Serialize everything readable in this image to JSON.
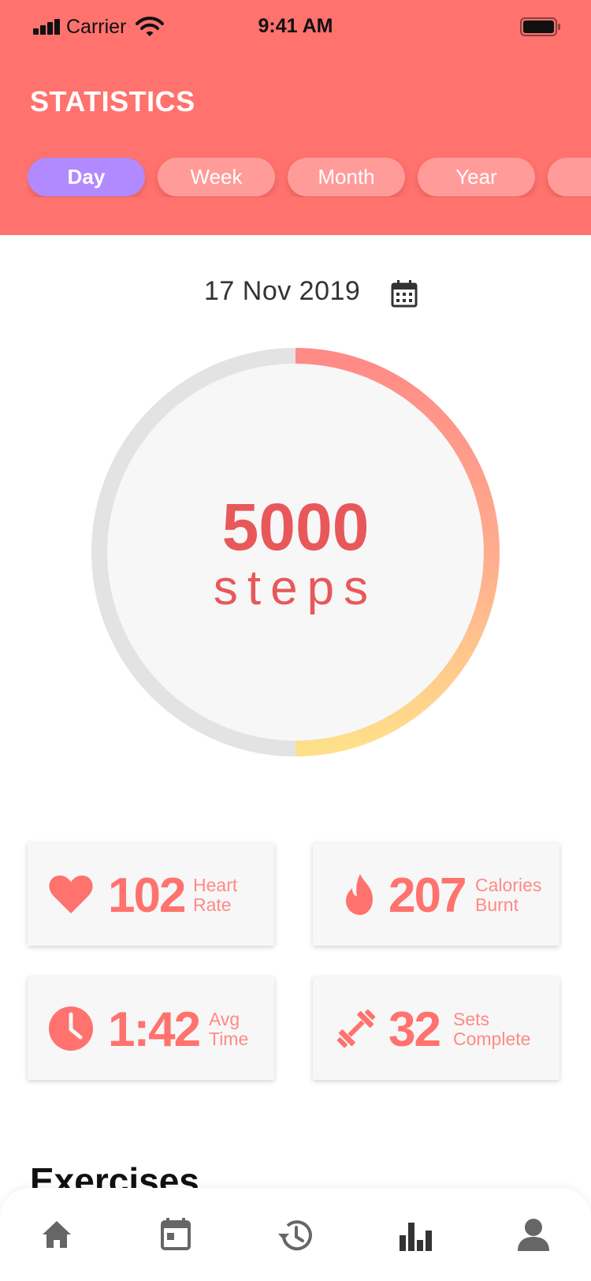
{
  "status_bar": {
    "carrier": "Carrier",
    "time": "9:41 AM"
  },
  "header": {
    "title": "STATISTICS"
  },
  "tabs": [
    {
      "label": "Day",
      "active": true
    },
    {
      "label": "Week",
      "active": false
    },
    {
      "label": "Month",
      "active": false
    },
    {
      "label": "Year",
      "active": false
    },
    {
      "label": "",
      "active": false
    }
  ],
  "date": {
    "text": "17 Nov 2019",
    "icon": "calendar-icon"
  },
  "progress": {
    "value": "5000",
    "unit": "steps",
    "fraction": 0.5
  },
  "stats": [
    {
      "icon": "heart-icon",
      "value": "102",
      "label_line1": "Heart",
      "label_line2": "Rate"
    },
    {
      "icon": "flame-icon",
      "value": "207",
      "label_line1": "Calories",
      "label_line2": "Burnt"
    },
    {
      "icon": "clock-icon",
      "value": "1:42",
      "label_line1": "Avg",
      "label_line2": "Time"
    },
    {
      "icon": "dumbbell-icon",
      "value": "32",
      "label_line1": "Sets",
      "label_line2": "Complete"
    }
  ],
  "section": {
    "title": "Exercises"
  },
  "bottom_nav": [
    {
      "name": "home",
      "icon": "home-icon"
    },
    {
      "name": "calendar",
      "icon": "calendar-icon"
    },
    {
      "name": "history",
      "icon": "history-icon"
    },
    {
      "name": "statistics",
      "icon": "bar-chart-icon",
      "active": true
    },
    {
      "name": "profile",
      "icon": "person-icon"
    }
  ],
  "colors": {
    "header_bg": "#ff726d",
    "active_tab": "#b18aff",
    "inactive_tab": "#ff9c9a",
    "accent": "#ff726d",
    "steps_text": "#e8585a",
    "ring_track": "#e3e3e3",
    "ring_gradient_start": "#ff8a86",
    "ring_gradient_end": "#ffe08a"
  }
}
